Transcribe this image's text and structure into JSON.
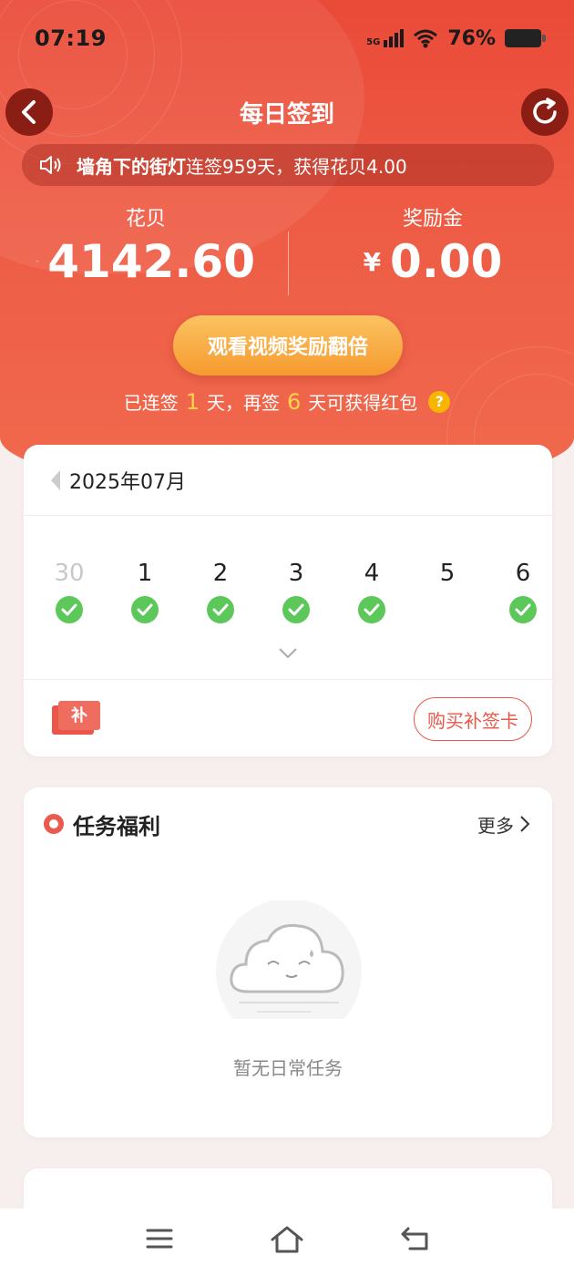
{
  "status": {
    "time": "07:19",
    "signal": "5G",
    "battery": "76%"
  },
  "header": {
    "title": "每日签到"
  },
  "marquee": {
    "name": "墙角下的街灯",
    "text": "连签959天，获得花贝4.00"
  },
  "balances": {
    "huabei_label": "花贝",
    "huabei_value": "4142.60",
    "bonus_label": "奖励金",
    "bonus_currency": "¥",
    "bonus_value": "0.00"
  },
  "double_button": "观看视频奖励翻倍",
  "streak": {
    "prefix": "已连签",
    "days": "1",
    "mid": "天，再签",
    "remaining": "6",
    "suffix": "天可获得红包",
    "help": "?"
  },
  "calendar": {
    "month": "2025年07月",
    "days": [
      {
        "num": "30",
        "checked": true,
        "muted": true
      },
      {
        "num": "1",
        "checked": true,
        "muted": false
      },
      {
        "num": "2",
        "checked": true,
        "muted": false
      },
      {
        "num": "3",
        "checked": true,
        "muted": false
      },
      {
        "num": "4",
        "checked": true,
        "muted": false
      },
      {
        "num": "5",
        "checked": false,
        "muted": false
      },
      {
        "num": "6",
        "checked": true,
        "muted": false
      }
    ],
    "makeup_icon_text": "补",
    "buy_button": "购买补签卡"
  },
  "tasks": {
    "title": "任务福利",
    "more": "更多",
    "empty": "暂无日常任务"
  },
  "colors": {
    "primary": "#ea4a38",
    "accent": "#f69a2f",
    "check": "#5cc85a",
    "highlight": "#ffd24a"
  }
}
